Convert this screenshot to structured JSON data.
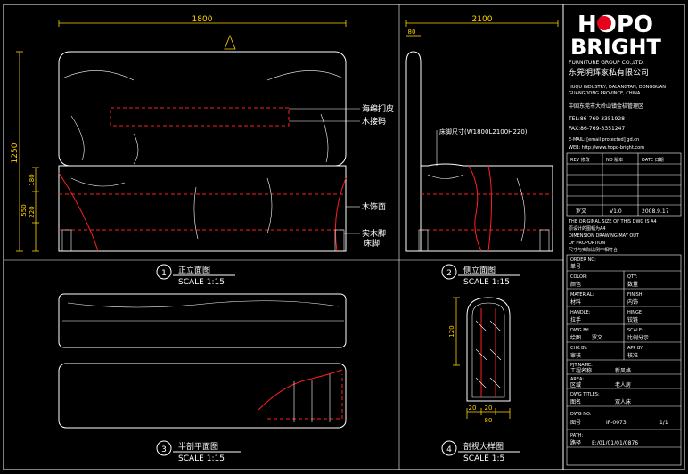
{
  "colors": {
    "background": "#000000",
    "line": "#ffffff",
    "accent": "#ff2020",
    "dimension": "#ffd400",
    "logo_dot": "#e8001c"
  },
  "dimensions": {
    "front_width": "1800",
    "side_width": "2100",
    "side_top": "80",
    "total_height": "1250",
    "front_h180": "180",
    "front_h550": "550",
    "front_h220": "220",
    "section_h": "120",
    "section_b1": "20",
    "section_b2": "20",
    "section_w": "80"
  },
  "callouts": {
    "leather": "海绵扪皮",
    "wood_frame": "木接码",
    "wood_panel": "木饰面",
    "solid_leg": "实木脚",
    "bed_foot": "床脚",
    "bed_size": "床脚尺寸(W1800L2100H220)"
  },
  "views": {
    "v1": {
      "num": "1",
      "cn": "正立面图",
      "scale": "SCALE 1:15"
    },
    "v2": {
      "num": "2",
      "cn": "侧立面图",
      "scale": "SCALE 1:15"
    },
    "v3": {
      "num": "3",
      "cn": "半剖平面图",
      "scale": "SCALE 1:15"
    },
    "v4": {
      "num": "4",
      "cn": "剖视大样图",
      "scale": "SCALE 1:5"
    }
  },
  "title_block": {
    "logo_top": "HOPO",
    "logo_bottom": "BRIGHT",
    "company_en": "FURNITURE GROUP CO.,LTD.",
    "company_cn": "东莞明辉家私有限公司",
    "address_1": "HUQU INDUSTRY, DALANGTAN, DONGGUAN",
    "address_2": "GUANGDONG PROVINCE, CHINA",
    "address_cn": "中国东莞市大岭山镇金桔管理区",
    "tel": "TEL:86-769-3351928",
    "fax": "FAX:86-769-3351247",
    "email": "E-MAIL: [email protected] gd.cn",
    "web": "WEB: http://www.hopo-bright.com",
    "rev_headers": [
      "REV 修改",
      "NO 版本",
      "DATE 日期"
    ],
    "rev_row": [
      "罗文",
      "V1.0",
      "2008.9.17"
    ],
    "note_en_1": "THE ORIGINAL SIZE OF THIS DWG IS A4",
    "note_cn_1": "原设计的图幅为A4",
    "note_en_2": "DIMENSION DRAWING MAY OUT",
    "note_en_3": "OF PROPORTION",
    "note_cn_2": "尺寸与实际比例不相符合",
    "order_no_label": "ORDER NO:",
    "order_no_cn": "单号",
    "color_label": "COLOR:",
    "color_cn": "颜色",
    "qty_label": "QTY:",
    "qty_cn": "数量",
    "material_label": "MATERIAL:",
    "material_cn": "材料",
    "finish_label": "FINISH",
    "finish_cn": "内饰",
    "handle_label": "HANDLE:",
    "handle_cn": "拉手",
    "hinge_label": "HINGE",
    "hinge_cn": "铰链",
    "dwg_by_label": "DWG BY:",
    "dwg_by_cn": "绘图",
    "dwg_by_value": "罗文",
    "scale_label": "SCALE:",
    "scale_cn": "比例分示",
    "chk_by_label": "CHK BY:",
    "chk_by_cn": "审核",
    "app_by_label": "APP BY:",
    "app_by_cn": "核准",
    "pjt_name_label": "PJT.NAME:",
    "pjt_name_cn": "工程名称",
    "pjt_name_value": "新风格",
    "area_label": "AREA:",
    "area_cn": "区域",
    "area_value": "老人房",
    "dwg_titles_label": "DWG TITLES:",
    "dwg_titles_cn": "图名",
    "dwg_titles_value": "双人床",
    "dwg_no_label": "DWG NO:",
    "dwg_no_cn": "图号",
    "dwg_no_value": "IP-0073",
    "sheet": "1/1",
    "path_label": "PATH:",
    "path_cn": "路径",
    "path_value": "E:/01/01/01/0876"
  }
}
